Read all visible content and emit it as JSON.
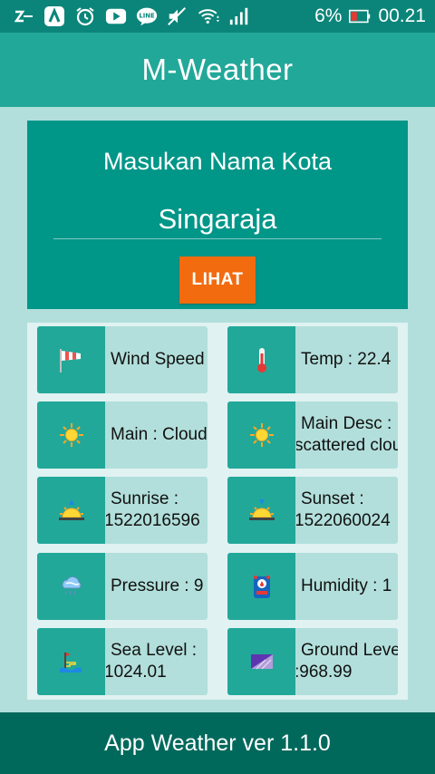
{
  "status_bar": {
    "battery_percent": "6%",
    "time": "00.21",
    "icons": [
      "zap-icon",
      "nav-icon",
      "alarm-icon",
      "youtube-icon",
      "line-icon",
      "mute-icon",
      "wifi-icon",
      "signal-icon",
      "battery-icon"
    ]
  },
  "app": {
    "title": "M-Weather"
  },
  "search": {
    "prompt": "Masukan Nama Kota",
    "city_value": "Singaraja",
    "button_label": "LIHAT"
  },
  "cards": [
    {
      "icon": "windsock-icon",
      "line1": "Wind Speed : ",
      "line2": ""
    },
    {
      "icon": "thermometer-icon",
      "line1": "Temp : 22.4",
      "line2": ""
    },
    {
      "icon": "sun-icon",
      "line1": "Main : Clouds",
      "line2": ""
    },
    {
      "icon": "sun-icon",
      "line1": "Main Desc :",
      "line2": "scattered clouds"
    },
    {
      "icon": "sunrise-icon",
      "line1": "Sunrise :",
      "line2": "1522016596"
    },
    {
      "icon": "sunset-icon",
      "line1": "Sunset :",
      "line2": "1522060024"
    },
    {
      "icon": "pressure-icon",
      "line1": "Pressure : 9",
      "line2": ""
    },
    {
      "icon": "humidity-icon",
      "line1": "Humidity : 1",
      "line2": ""
    },
    {
      "icon": "sea-level-icon",
      "line1": "Sea Level :",
      "line2": "1024.01"
    },
    {
      "icon": "ground-level-icon",
      "line1": "Ground Level",
      "line2": ":968.99"
    }
  ],
  "footer": {
    "text": "App Weather ver 1.1.0"
  },
  "colors": {
    "status_bar": "#0b8579",
    "app_bar": "#22a899",
    "panel": "#009688",
    "button": "#f26b0f",
    "footer": "#00695c",
    "background": "#b2dfdb"
  }
}
